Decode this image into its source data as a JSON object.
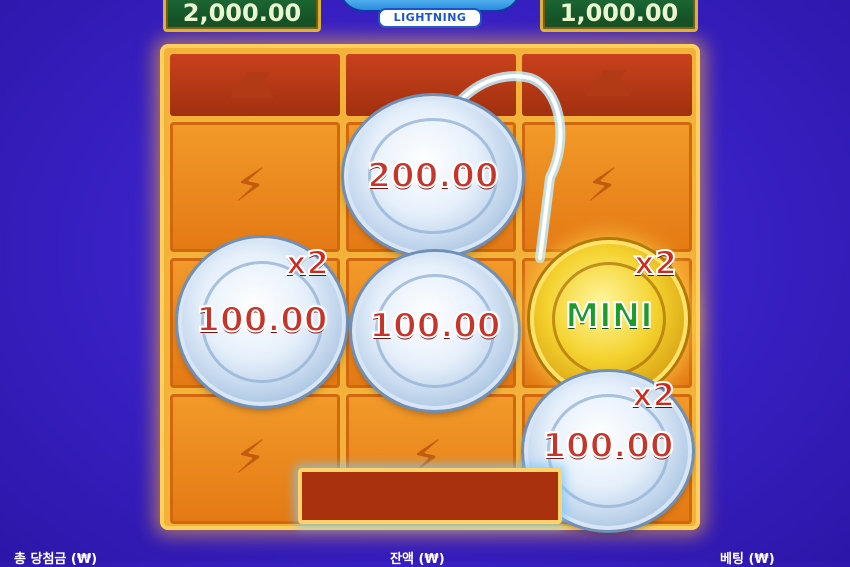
{
  "jackpots": {
    "left_value": "2,000.00",
    "right_value": "1,000.00"
  },
  "logo": {
    "subtitle": "LIGHTNING"
  },
  "grid": {
    "coins": [
      {
        "id": "coin-top-center",
        "value": "200.00",
        "type": "silver",
        "multiplier": ""
      },
      {
        "id": "coin-mid-left",
        "value": "100.00",
        "type": "silver",
        "multiplier": "x2"
      },
      {
        "id": "coin-mid-center",
        "value": "100.00",
        "type": "silver",
        "multiplier": ""
      },
      {
        "id": "coin-mid-right",
        "value": "MINI",
        "type": "gold",
        "multiplier": "x2"
      },
      {
        "id": "coin-bottom-right",
        "value": "100.00",
        "type": "silver",
        "multiplier": "x2"
      }
    ],
    "icons": {
      "empty_cell": "lightning-bolt-icon",
      "top_row": "gold-bars-icon"
    }
  },
  "footer": {
    "total_win_label": "총 당첨금 (₩)",
    "balance_label": "잔액 (₩)",
    "bet_label": "베팅 (₩)"
  },
  "colors": {
    "background": "#3a22c8",
    "board": "#f3b23a",
    "cell": "#e47914",
    "value_red": "#c7342a",
    "mini_green": "#1c9a2a"
  }
}
